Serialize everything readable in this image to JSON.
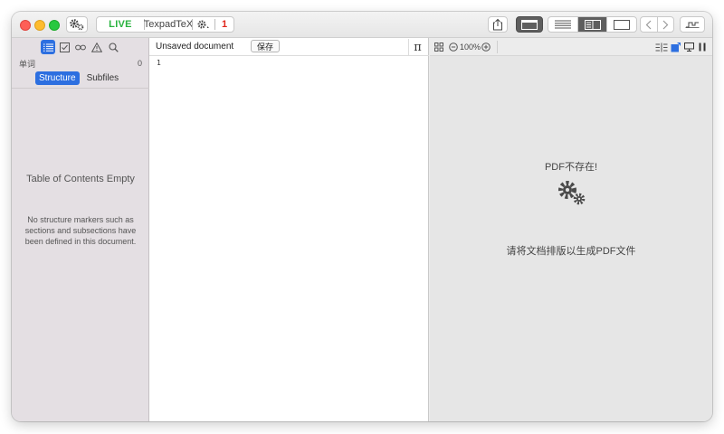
{
  "toolbar": {
    "live_label": "LIVE",
    "engine_label": "TexpadTeX",
    "error_count": "1"
  },
  "sidebar": {
    "tabs": [
      {
        "icon": "list-icon",
        "active": true
      },
      {
        "icon": "checkbox-icon",
        "active": false
      },
      {
        "icon": "link-icon",
        "active": false
      },
      {
        "icon": "warning-icon",
        "active": false
      },
      {
        "icon": "search-icon",
        "active": false
      }
    ],
    "wordcount_label": "单词",
    "wordcount_value": "0",
    "segments": {
      "structure": "Structure",
      "subfiles": "Subfiles"
    },
    "toc_title": "Table of Contents Empty",
    "toc_description": "No structure markers such as sections and subsections have been defined in this document."
  },
  "editor": {
    "document_title": "Unsaved document",
    "save_label": "保存",
    "pi_symbol": "π",
    "line_number": "1"
  },
  "preview": {
    "zoom": "100%",
    "pdf_missing": "PDF不存在!",
    "typeset_hint": "请将文档排版以生成PDF文件"
  },
  "colors": {
    "accent": "#2d6fe0",
    "live_green": "#29b33f",
    "error_red": "#e0261b",
    "sidebar_bg": "#e4dfe3",
    "preview_bg": "#e6e6e6"
  }
}
